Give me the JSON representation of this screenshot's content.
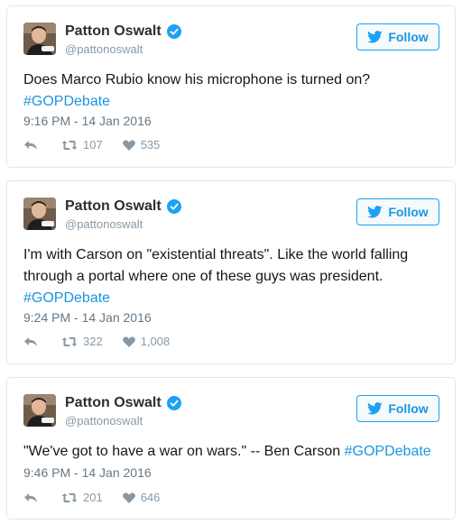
{
  "colors": {
    "link": "#1b95e0",
    "icon": "#8899a6",
    "verified": "#1da1f2"
  },
  "tweets": [
    {
      "name": "Patton Oswalt",
      "handle": "@pattonoswalt",
      "follow_label": "Follow",
      "text": "Does Marco Rubio know his microphone is turned on?",
      "hashtag": "#GOPDebate",
      "timestamp": "9:16 PM - 14 Jan 2016",
      "retweets": "107",
      "likes": "535"
    },
    {
      "name": "Patton Oswalt",
      "handle": "@pattonoswalt",
      "follow_label": "Follow",
      "text": "I'm with Carson on \"existential threats\". Like the world falling through a portal where one of these guys was president.",
      "hashtag": "#GOPDebate",
      "timestamp": "9:24 PM - 14 Jan 2016",
      "retweets": "322",
      "likes": "1,008"
    },
    {
      "name": "Patton Oswalt",
      "handle": "@pattonoswalt",
      "follow_label": "Follow",
      "text": "\"We've got to have a war on wars.\" -- Ben Carson",
      "hashtag": "#GOPDebate",
      "timestamp": "9:46 PM - 14 Jan 2016",
      "retweets": "201",
      "likes": "646"
    }
  ]
}
